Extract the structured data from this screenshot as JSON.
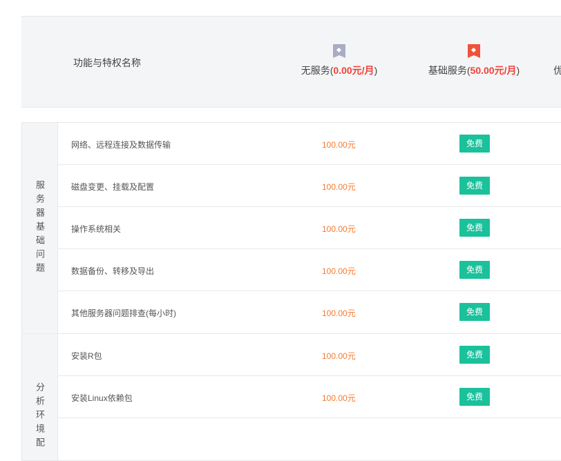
{
  "header": {
    "title": "功能与特权名称",
    "plans": [
      {
        "name": "无服务(",
        "price": "0.00元/月",
        "close": ")",
        "flag_color": "#a9acc4"
      },
      {
        "name": "基础服务(",
        "price": "50.00元/月",
        "close": ")",
        "flag_color": "#f0533c"
      },
      {
        "name": "优"
      }
    ]
  },
  "groups": [
    {
      "label": "服务器基础问题",
      "rows": [
        {
          "name": "网络、远程连接及数据传输",
          "price": "100.00元",
          "badge": "免费"
        },
        {
          "name": "磁盘变更、挂载及配置",
          "price": "100.00元",
          "badge": "免费"
        },
        {
          "name": "操作系统相关",
          "price": "100.00元",
          "badge": "免费"
        },
        {
          "name": "数据备份、转移及导出",
          "price": "100.00元",
          "badge": "免费"
        },
        {
          "name": "其他服务器问题排查(每小时)",
          "price": "100.00元",
          "badge": "免费"
        }
      ]
    },
    {
      "label": "分析环境配",
      "rows": [
        {
          "name": "安装R包",
          "price": "100.00元",
          "badge": "免费"
        },
        {
          "name": "安装Linux依赖包",
          "price": "100.00元",
          "badge": "免费"
        },
        {
          "name": "",
          "price": "",
          "badge": ""
        }
      ]
    }
  ],
  "colors": {
    "accent_green": "#1bc19b",
    "price_orange": "#f5782d",
    "price_red": "#f04134"
  }
}
